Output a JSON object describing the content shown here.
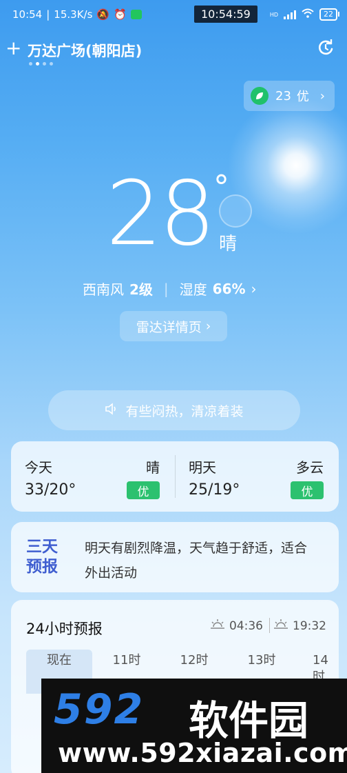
{
  "status_bar": {
    "time": "10:54",
    "speed": "15.3K/s",
    "clock_chip": "10:54:59",
    "signal_label": "HD",
    "battery": "22"
  },
  "header": {
    "add_icon": "plus-icon",
    "city": "万达广场(朝阳店)",
    "page_dots": 4,
    "active_dot": 2,
    "refresh_icon": "refresh-icon"
  },
  "aqi": {
    "value": "23",
    "level": "优",
    "icon": "leaf-icon",
    "chevron": "›"
  },
  "current": {
    "temperature": "28",
    "degree_symbol": "°",
    "condition": "晴",
    "wind_dir": "西南风",
    "wind_level": "2级",
    "humidity_label": "湿度",
    "humidity": "66%",
    "chevron": "›",
    "radar_button": "雷达详情页",
    "radar_chevron": "›",
    "tip": "有些闷热，清凉着装",
    "tip_icon": "speaker-icon"
  },
  "days": [
    {
      "label": "今天",
      "condition": "晴",
      "range": "33/20°",
      "aqi": "优"
    },
    {
      "label": "明天",
      "condition": "多云",
      "range": "25/19°",
      "aqi": "优"
    }
  ],
  "three_day": {
    "title": "三天预报",
    "text": "明天有剧烈降温，天气趋于舒适，适合外出活动"
  },
  "hourly": {
    "title": "24小时预报",
    "sunrise": "04:36",
    "sunset": "19:32",
    "hours": [
      "现在",
      "11时",
      "12时",
      "13时",
      "14时"
    ]
  },
  "watermark": {
    "logo_num": "592",
    "logo_text": "软件园",
    "url": "www.592xiazai.com"
  },
  "colors": {
    "sky_top": "#3d9bef",
    "sky_bottom": "#d6ecfd",
    "aqi_green": "#2cc16f",
    "three_day_blue": "#3f5ed0"
  }
}
